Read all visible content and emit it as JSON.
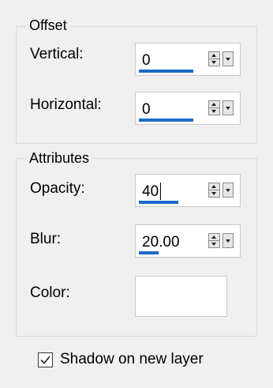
{
  "offset": {
    "title": "Offset",
    "vertical_label": "Vertical:",
    "vertical_value": "0",
    "vertical_fill": 0.55,
    "horizontal_label": "Horizontal:",
    "horizontal_value": "0",
    "horizontal_fill": 0.55
  },
  "attributes": {
    "title": "Attributes",
    "opacity_label": "Opacity:",
    "opacity_value": "40",
    "opacity_fill": 0.4,
    "blur_label": "Blur:",
    "blur_value": "20.00",
    "blur_fill": 0.2,
    "color_label": "Color:",
    "color_value": "#ffffff"
  },
  "shadow_layer": {
    "label": "Shadow on new layer",
    "checked": true
  },
  "colors": {
    "slider_fill": "#1b6ac9",
    "background": "#f0f0f0"
  }
}
